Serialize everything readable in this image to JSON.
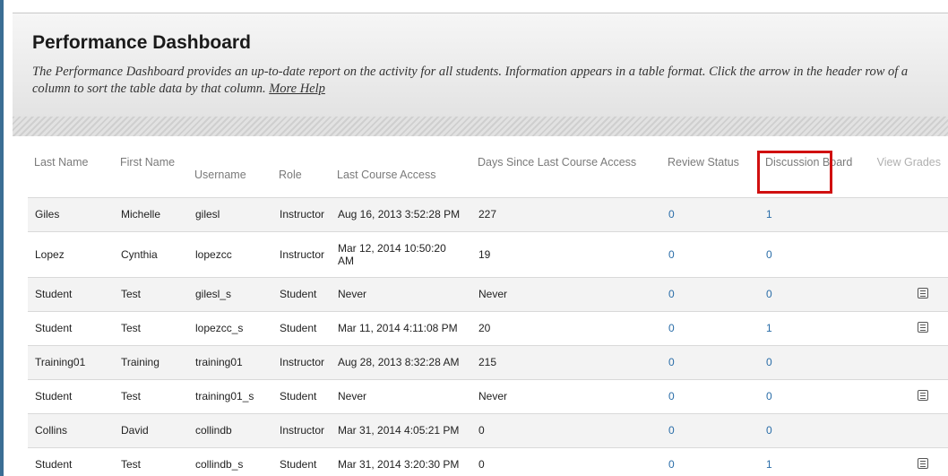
{
  "page": {
    "title": "Performance Dashboard",
    "description": "The Performance Dashboard provides an up-to-date report on the activity for all students. Information appears in a table format. Click the arrow in the header row of a column to sort the table data by that column.",
    "more_help": "More Help"
  },
  "table": {
    "headers": {
      "last_name": "Last Name",
      "first_name": "First Name",
      "username": "Username",
      "role": "Role",
      "last_access": "Last Course Access",
      "days_since": "Days Since Last Course Access",
      "review_status": "Review Status",
      "discussion_board": "Discussion Board",
      "view_grades": "View Grades"
    },
    "rows": [
      {
        "last": "Giles",
        "first": "Michelle",
        "user": "gilesl",
        "role": "Instructor",
        "access": "Aug 16, 2013 3:52:28 PM",
        "days": "227",
        "review": "0",
        "discussion": "1",
        "grades": false
      },
      {
        "last": "Lopez",
        "first": "Cynthia",
        "user": "lopezcc",
        "role": "Instructor",
        "access": "Mar 12, 2014 10:50:20 AM",
        "days": "19",
        "review": "0",
        "discussion": "0",
        "grades": false
      },
      {
        "last": "Student",
        "first": "Test",
        "user": "gilesl_s",
        "role": "Student",
        "access": "Never",
        "days": "Never",
        "review": "0",
        "discussion": "0",
        "grades": true
      },
      {
        "last": "Student",
        "first": "Test",
        "user": "lopezcc_s",
        "role": "Student",
        "access": "Mar 11, 2014 4:11:08 PM",
        "days": "20",
        "review": "0",
        "discussion": "1",
        "grades": true
      },
      {
        "last": "Training01",
        "first": "Training",
        "user": "training01",
        "role": "Instructor",
        "access": "Aug 28, 2013 8:32:28 AM",
        "days": "215",
        "review": "0",
        "discussion": "0",
        "grades": false
      },
      {
        "last": "Student",
        "first": "Test",
        "user": "training01_s",
        "role": "Student",
        "access": "Never",
        "days": "Never",
        "review": "0",
        "discussion": "0",
        "grades": true
      },
      {
        "last": "Collins",
        "first": "David",
        "user": "collindb",
        "role": "Instructor",
        "access": "Mar 31, 2014 4:05:21 PM",
        "days": "0",
        "review": "0",
        "discussion": "0",
        "grades": false
      },
      {
        "last": "Student",
        "first": "Test",
        "user": "collindb_s",
        "role": "Student",
        "access": "Mar 31, 2014 3:20:30 PM",
        "days": "0",
        "review": "0",
        "discussion": "1",
        "grades": true
      }
    ]
  },
  "icons": {
    "grades_icon": "grade-details-icon"
  },
  "colors": {
    "highlight_box": "#d01010",
    "link": "#2a6da8"
  }
}
